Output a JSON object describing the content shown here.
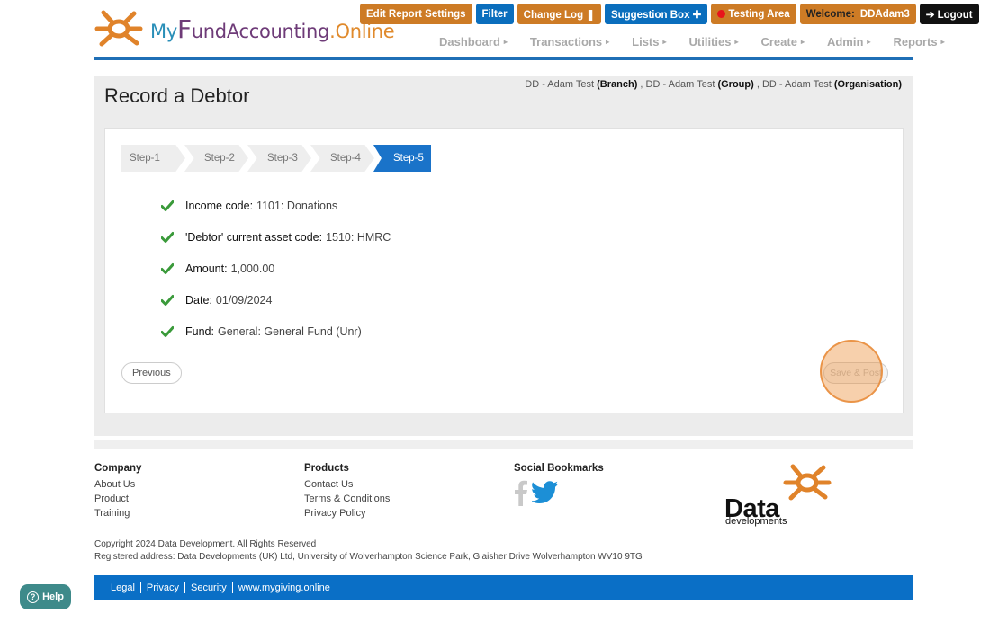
{
  "logo": {
    "my": "My",
    "f": "F",
    "und_accounting": "undAccounting",
    "dot_online": ".Online"
  },
  "topbar": {
    "edit_report": "Edit Report Settings",
    "filter": "Filter",
    "change_log": "Change Log ❚",
    "suggestion_box": "Suggestion Box ✚",
    "testing_area": "Testing Area",
    "welcome_label": "Welcome:",
    "welcome_user": "DDAdam3",
    "logout": "➔ Logout"
  },
  "nav": [
    "Dashboard",
    "Transactions",
    "Lists",
    "Utilities",
    "Create",
    "Admin",
    "Reports"
  ],
  "page": {
    "title": "Record a Debtor",
    "breadcrumb": {
      "branch_name": "DD - Adam Test",
      "branch_tag": "(Branch)",
      "group_name": "DD - Adam Test",
      "group_tag": "(Group)",
      "org_name": "DD - Adam Test",
      "org_tag": "(Organisation)"
    }
  },
  "steps": [
    "Step-1",
    "Step-2",
    "Step-3",
    "Step-4",
    "Step-5"
  ],
  "active_step": 5,
  "summary": [
    {
      "label": "Income code:",
      "value": "1101: Donations"
    },
    {
      "label": "'Debtor' current asset code:",
      "value": "1510: HMRC"
    },
    {
      "label": "Amount:",
      "value": "1,000.00"
    },
    {
      "label": "Date:",
      "value": "01/09/2024"
    },
    {
      "label": "Fund:",
      "value": "General: General Fund (Unr)"
    }
  ],
  "buttons": {
    "previous": "Previous",
    "save_post": "Save & Post"
  },
  "footer": {
    "company": {
      "head": "Company",
      "links": [
        "About Us",
        "Product",
        "Training"
      ]
    },
    "products": {
      "head": "Products",
      "links": [
        "Contact Us",
        "Terms & Conditions",
        "Privacy Policy"
      ]
    },
    "social": {
      "head": "Social Bookmarks"
    },
    "dd_logo": {
      "word": "Data",
      "sub": "developments"
    },
    "copyright": "Copyright 2024 Data Development. All Rights Reserved",
    "address": "Registered address: Data Developments (UK) Ltd, University of Wolverhampton Science Park, Glaisher Drive Wolverhampton WV10 9TG",
    "bar_links": [
      "Legal",
      "Privacy",
      "Security",
      "www.mygiving.online"
    ]
  },
  "help": {
    "label": "Help",
    "q": "?"
  },
  "colors": {
    "orange": "#cd7b25",
    "blue": "#0a6ebd",
    "step_active": "#1a73c9",
    "check_green": "#3a9a3a",
    "footer_bar": "#0a6fc6"
  }
}
